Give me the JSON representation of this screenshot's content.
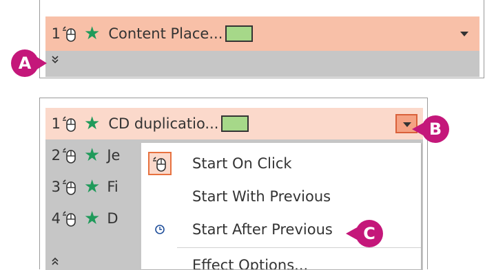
{
  "top_panel": {
    "item": {
      "number": "1",
      "name": "Content Place...",
      "swatch_color": "#a6d889"
    },
    "expand_icon": "chevron-double-down-icon"
  },
  "bottom_panel": {
    "rows": [
      {
        "number": "1",
        "name": "CD duplicatio...",
        "selected": true
      },
      {
        "number": "2",
        "name": "Je"
      },
      {
        "number": "3",
        "name": "Fi"
      },
      {
        "number": "4",
        "name": "D"
      }
    ],
    "collapse_icon": "chevron-double-up-icon"
  },
  "menu": {
    "items": [
      {
        "label": "Start On Click",
        "icon": "mouse-click-icon"
      },
      {
        "label": "Start With Previous",
        "icon": ""
      },
      {
        "label": "Start After Previous",
        "icon": "clock-icon"
      },
      {
        "label": "Effect Options..."
      }
    ]
  },
  "callouts": {
    "a": "A",
    "b": "B",
    "c": "C"
  },
  "colors": {
    "selection": "#f8c0a8",
    "selection_light": "#fbd9cb",
    "accent_border": "#d9603a",
    "star": "#1f9a5a",
    "callout": "#c4177a"
  }
}
